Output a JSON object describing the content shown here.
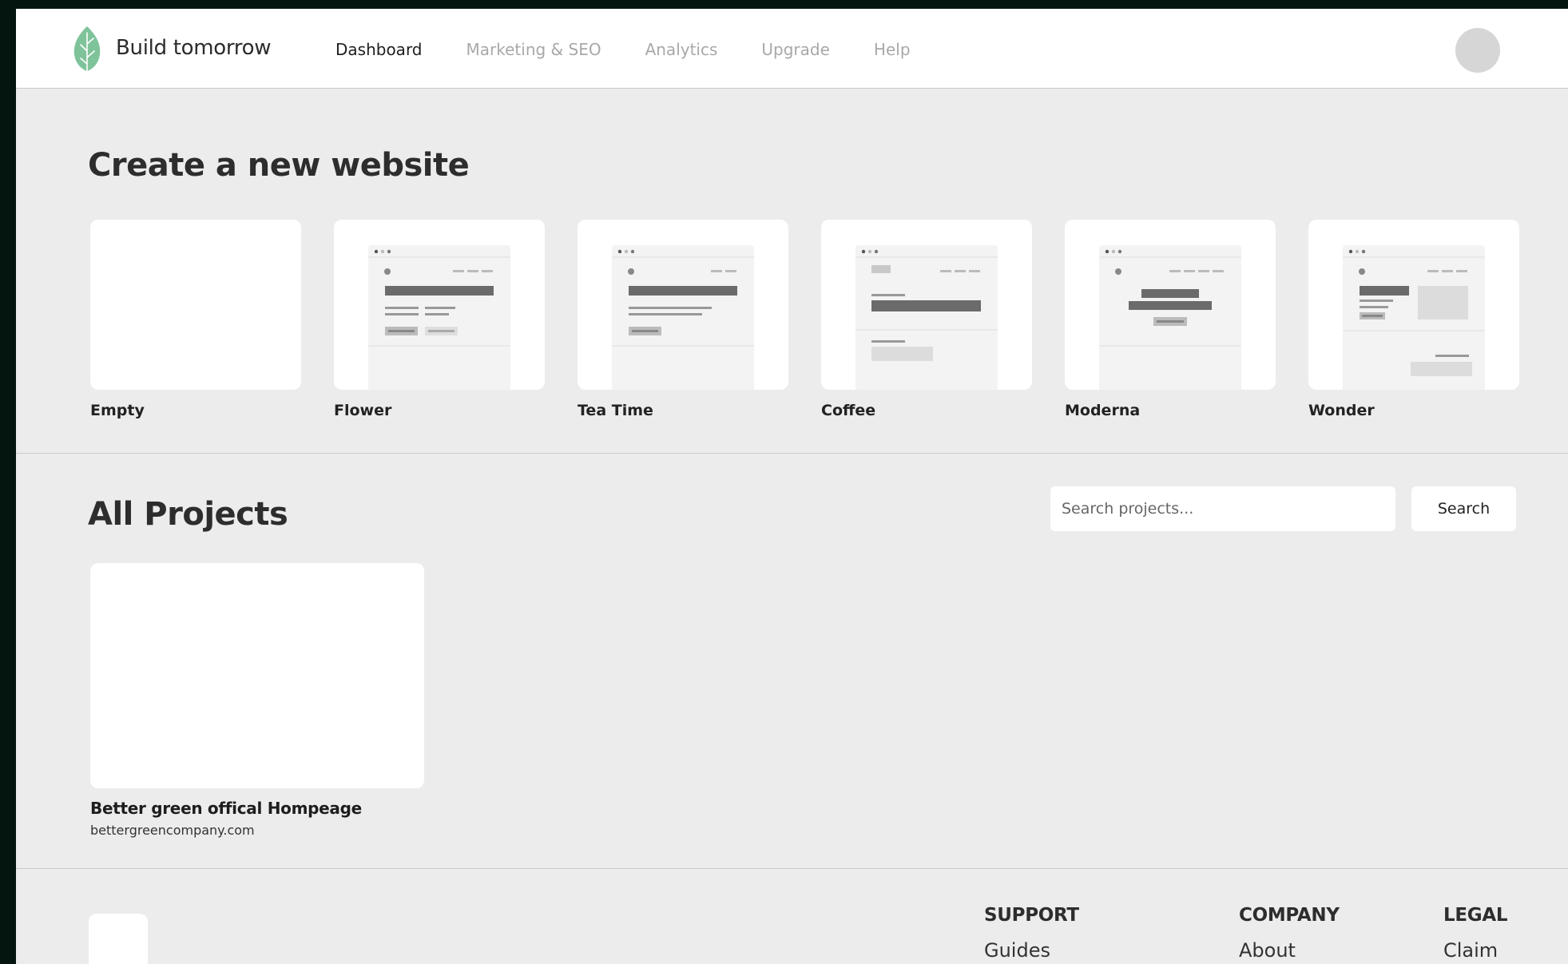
{
  "app": {
    "brand": "Build tomorrow",
    "accent_color": "#7fc39a",
    "logo_icon": "leaf-icon"
  },
  "nav": {
    "items": [
      {
        "label": "Dashboard",
        "active": true
      },
      {
        "label": "Marketing & SEO",
        "active": false
      },
      {
        "label": "Analytics",
        "active": false
      },
      {
        "label": "Upgrade",
        "active": false
      },
      {
        "label": "Help",
        "active": false
      }
    ]
  },
  "create": {
    "title": "Create a new website",
    "templates": [
      {
        "label": "Empty"
      },
      {
        "label": "Flower"
      },
      {
        "label": "Tea Time"
      },
      {
        "label": "Coffee"
      },
      {
        "label": "Moderna"
      },
      {
        "label": "Wonder"
      }
    ]
  },
  "projects": {
    "title": "All Projects",
    "search_placeholder": "Search projects...",
    "search_button": "Search",
    "items": [
      {
        "name": "Better green offical Hompeage",
        "url": "bettergreencompany.com"
      }
    ]
  },
  "footer": {
    "columns": [
      {
        "heading": "SUPPORT",
        "links": [
          "Guides"
        ]
      },
      {
        "heading": "COMPANY",
        "links": [
          "About"
        ]
      },
      {
        "heading": "LEGAL",
        "links": [
          "Claim"
        ]
      }
    ]
  }
}
